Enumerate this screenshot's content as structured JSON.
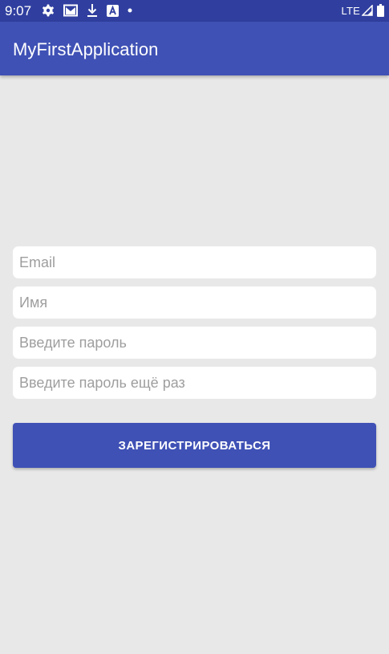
{
  "status_bar": {
    "time": "9:07",
    "icons_left": [
      "gear-icon",
      "mail-icon",
      "download-icon",
      "a-badge-icon",
      "dot-icon"
    ],
    "network": "LTE",
    "icons_right": [
      "signal-icon",
      "battery-icon"
    ]
  },
  "app_bar": {
    "title": "MyFirstApplication",
    "color": "#3f51b5"
  },
  "form": {
    "email_placeholder": "Email",
    "name_placeholder": "Имя",
    "password_placeholder": "Введите пароль",
    "password_repeat_placeholder": "Введите пароль ещё раз",
    "register_label": "ЗАРЕГИСТРИРОВАТЬСЯ"
  },
  "colors": {
    "status_bar": "#303f9f",
    "primary": "#3f51b5",
    "background": "#e8e8e8"
  }
}
